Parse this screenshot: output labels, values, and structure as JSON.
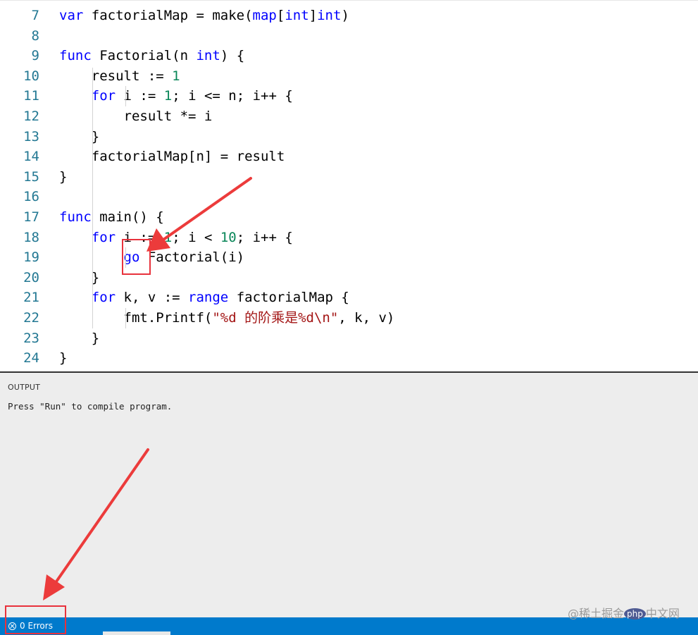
{
  "editor": {
    "lines": [
      {
        "n": "7",
        "tokens": [
          {
            "t": "var",
            "c": "kw"
          },
          {
            "t": " factorialMap = make(",
            "c": ""
          },
          {
            "t": "map",
            "c": "kw"
          },
          {
            "t": "[",
            "c": ""
          },
          {
            "t": "int",
            "c": "kw"
          },
          {
            "t": "]",
            "c": ""
          },
          {
            "t": "int",
            "c": "kw"
          },
          {
            "t": ")",
            "c": ""
          }
        ]
      },
      {
        "n": "8",
        "tokens": []
      },
      {
        "n": "9",
        "tokens": [
          {
            "t": "func",
            "c": "kw"
          },
          {
            "t": " Factorial(n ",
            "c": ""
          },
          {
            "t": "int",
            "c": "kw"
          },
          {
            "t": ") {",
            "c": ""
          }
        ]
      },
      {
        "n": "10",
        "tokens": [
          {
            "t": "    result := ",
            "c": ""
          },
          {
            "t": "1",
            "c": "num"
          }
        ]
      },
      {
        "n": "11",
        "tokens": [
          {
            "t": "    ",
            "c": ""
          },
          {
            "t": "for",
            "c": "kw"
          },
          {
            "t": " i := ",
            "c": ""
          },
          {
            "t": "1",
            "c": "num"
          },
          {
            "t": "; i <= n; i++ {",
            "c": ""
          }
        ]
      },
      {
        "n": "12",
        "tokens": [
          {
            "t": "        result *= i",
            "c": ""
          }
        ]
      },
      {
        "n": "13",
        "tokens": [
          {
            "t": "    }",
            "c": ""
          }
        ]
      },
      {
        "n": "14",
        "tokens": [
          {
            "t": "    factorialMap[n] = result",
            "c": ""
          }
        ]
      },
      {
        "n": "15",
        "tokens": [
          {
            "t": "}",
            "c": ""
          }
        ]
      },
      {
        "n": "16",
        "tokens": []
      },
      {
        "n": "17",
        "tokens": [
          {
            "t": "func",
            "c": "kw"
          },
          {
            "t": " main() {",
            "c": ""
          }
        ]
      },
      {
        "n": "18",
        "tokens": [
          {
            "t": "    ",
            "c": ""
          },
          {
            "t": "for",
            "c": "kw"
          },
          {
            "t": " i := ",
            "c": ""
          },
          {
            "t": "1",
            "c": "num"
          },
          {
            "t": "; i < ",
            "c": ""
          },
          {
            "t": "10",
            "c": "num"
          },
          {
            "t": "; i++ {",
            "c": ""
          }
        ]
      },
      {
        "n": "19",
        "tokens": [
          {
            "t": "        ",
            "c": ""
          },
          {
            "t": "go",
            "c": "kw"
          },
          {
            "t": " Factorial(i)",
            "c": ""
          }
        ]
      },
      {
        "n": "20",
        "tokens": [
          {
            "t": "    }",
            "c": ""
          }
        ]
      },
      {
        "n": "21",
        "tokens": [
          {
            "t": "    ",
            "c": ""
          },
          {
            "t": "for",
            "c": "kw"
          },
          {
            "t": " k, v := ",
            "c": ""
          },
          {
            "t": "range",
            "c": "kw"
          },
          {
            "t": " factorialMap {",
            "c": ""
          }
        ]
      },
      {
        "n": "22",
        "tokens": [
          {
            "t": "        fmt.Printf(",
            "c": ""
          },
          {
            "t": "\"%d 的阶乘是%d\\n\"",
            "c": "str"
          },
          {
            "t": ", k, v)",
            "c": ""
          }
        ]
      },
      {
        "n": "23",
        "tokens": [
          {
            "t": "    }",
            "c": ""
          }
        ]
      },
      {
        "n": "24",
        "tokens": [
          {
            "t": "}",
            "c": ""
          }
        ]
      }
    ]
  },
  "output": {
    "title": "OUTPUT",
    "message": "Press \"Run\" to compile program."
  },
  "statusbar": {
    "errors_label": "0 Errors",
    "error_icon": "error-circle-icon"
  },
  "watermark": {
    "prefix": "@稀土掘金",
    "badge": "php",
    "suffix": "中文网"
  },
  "colors": {
    "keyword": "#0000ff",
    "number": "#098658",
    "string": "#a31515",
    "line_number": "#237893",
    "statusbar": "#007acc",
    "annotation": "#e8323c"
  }
}
